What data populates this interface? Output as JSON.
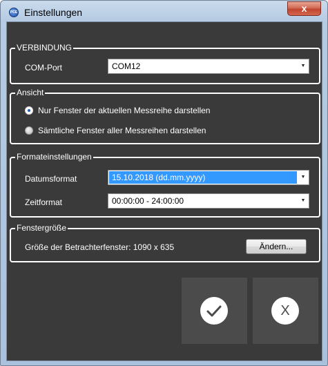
{
  "window": {
    "title": "Einstellungen",
    "close_glyph": "x",
    "app_icon_text": "PCE"
  },
  "verbindung": {
    "legend": "VERBINDUNG",
    "com_label": "COM-Port",
    "com_value": "COM12"
  },
  "ansicht": {
    "legend": "Ansicht",
    "options": [
      {
        "label": "Nur Fenster der aktuellen Messreihe darstellen",
        "selected": true
      },
      {
        "label": "Sämtliche Fenster aller Messreihen darstellen",
        "selected": false
      }
    ]
  },
  "formate": {
    "legend": "Formateinstellungen",
    "datum_label": "Datumsformat",
    "datum_value": "15.10.2018 (dd.mm.yyyy)",
    "zeit_label": "Zeitformat",
    "zeit_value": "00:00:00 - 24:00:00"
  },
  "fenster": {
    "legend": "Fenstergröße",
    "size_text": "Größe der Betrachterfenster: 1090 x 635",
    "change_button": "Ändern..."
  },
  "icons": {
    "ok": "checkmark-icon",
    "cancel": "x-icon",
    "x_glyph": "X"
  },
  "colors": {
    "client_bg": "#3a3a3a",
    "selection": "#3399ff",
    "button_tile": "#4b4b4b"
  }
}
